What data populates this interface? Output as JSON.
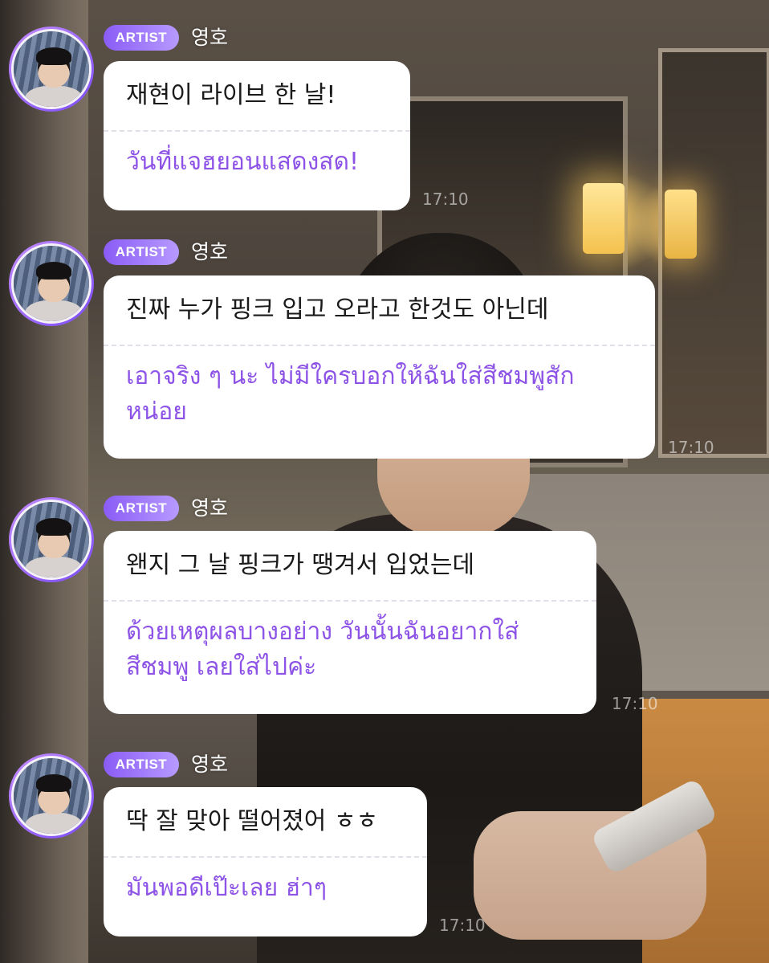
{
  "messages": [
    {
      "badge": "ARTIST",
      "nickname": "영호",
      "korean": "재현이 라이브 한 날!",
      "thai": "วันที่แจฮยอนแสดงสด!",
      "time": "17:10"
    },
    {
      "badge": "ARTIST",
      "nickname": "영호",
      "korean": "진짜 누가 핑크 입고 오라고 한것도 아닌데",
      "thai": "เอาจริง ๆ นะ ไม่มีใครบอกให้ฉันใส่สีชมพูสักหน่อย",
      "time": "17:10"
    },
    {
      "badge": "ARTIST",
      "nickname": "영호",
      "korean": "왠지 그 날 핑크가 땡겨서 입었는데",
      "thai": "ด้วยเหตุผลบางอย่าง วันนั้นฉันอยากใส่สีชมพู เลยใส่ไปค่ะ",
      "time": "17:10"
    },
    {
      "badge": "ARTIST",
      "nickname": "영호",
      "korean": "딱 잘 맞아 떨어졌어 ㅎㅎ",
      "thai": "มันพอดีเป๊ะเลย ฮ่าๆ",
      "time": "17:10"
    }
  ],
  "colors": {
    "badge_start": "#8a5cf6",
    "badge_end": "#b79aff",
    "translation_text": "#8d52e6",
    "bubble_bg": "#ffffff"
  },
  "icons": {
    "avatar": "user-avatar-photo"
  }
}
